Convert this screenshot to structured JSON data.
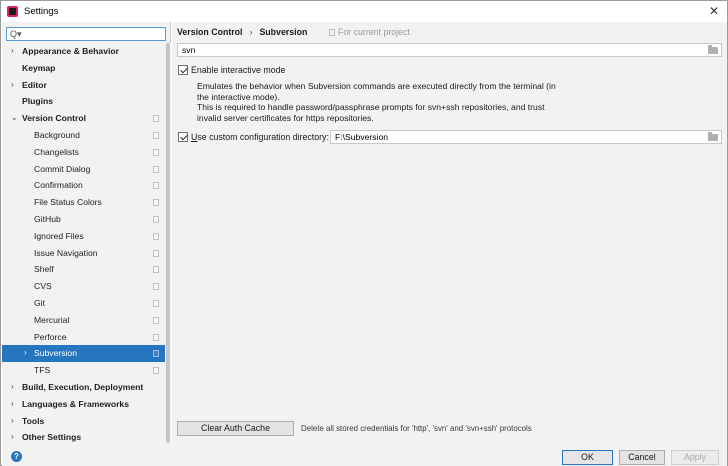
{
  "window": {
    "title": "Settings",
    "close_glyph": "✕"
  },
  "sidebar": {
    "search_glyph": "Q▾",
    "items": [
      {
        "label": "Appearance & Behavior",
        "bold": true,
        "arrow": "›",
        "depth": 0
      },
      {
        "label": "Keymap",
        "bold": true,
        "arrow": "",
        "depth": 0
      },
      {
        "label": "Editor",
        "bold": true,
        "arrow": "›",
        "depth": 0
      },
      {
        "label": "Plugins",
        "bold": true,
        "arrow": "",
        "depth": 0
      },
      {
        "label": "Version Control",
        "bold": true,
        "arrow": "⌄",
        "depth": 0,
        "project": true
      },
      {
        "label": "Background",
        "depth": 1,
        "project": true
      },
      {
        "label": "Changelists",
        "depth": 1,
        "project": true
      },
      {
        "label": "Commit Dialog",
        "depth": 1,
        "project": true
      },
      {
        "label": "Confirmation",
        "depth": 1,
        "project": true
      },
      {
        "label": "File Status Colors",
        "depth": 1,
        "project": true
      },
      {
        "label": "GitHub",
        "depth": 1,
        "project": true
      },
      {
        "label": "Ignored Files",
        "depth": 1,
        "project": true
      },
      {
        "label": "Issue Navigation",
        "depth": 1,
        "project": true
      },
      {
        "label": "Shelf",
        "depth": 1,
        "project": true
      },
      {
        "label": "CVS",
        "depth": 1,
        "project": true
      },
      {
        "label": "Git",
        "depth": 1,
        "project": true
      },
      {
        "label": "Mercurial",
        "depth": 1,
        "project": true
      },
      {
        "label": "Perforce",
        "depth": 1,
        "project": true
      },
      {
        "label": "Subversion",
        "depth": 1,
        "project": true,
        "arrow": "›",
        "selected": true
      },
      {
        "label": "TFS",
        "depth": 1,
        "project": true
      },
      {
        "label": "Build, Execution, Deployment",
        "bold": true,
        "arrow": "›",
        "depth": 0
      },
      {
        "label": "Languages & Frameworks",
        "bold": true,
        "arrow": "›",
        "depth": 0
      },
      {
        "label": "Tools",
        "bold": true,
        "arrow": "›",
        "depth": 0
      },
      {
        "label": "Other Settings",
        "bold": true,
        "arrow": "›",
        "depth": 0
      }
    ]
  },
  "main": {
    "breadcrumb": {
      "parent": "Version Control",
      "separator": "›",
      "current": "Subversion"
    },
    "for_project": "For current project",
    "path_value": "svn",
    "interactive_mode": {
      "checked": true,
      "label": "Enable interactive mode",
      "description": [
        "Emulates the behavior when Subversion commands are executed directly from the terminal (in",
        "the interactive mode).",
        "This is required to handle password/passphrase prompts for svn+ssh repositories, and trust",
        "invalid server certificates for https repositories."
      ]
    },
    "custom_config": {
      "checked": true,
      "label_mnemonic": "U",
      "label_rest": "se custom configuration directory:",
      "value": "F:\\Subversion"
    },
    "clear_auth": {
      "button": "Clear Auth Cache",
      "note": "Delete all stored credentials for 'http', 'svn' and 'svn+ssh' protocols"
    }
  },
  "footer": {
    "help_glyph": "?",
    "ok": "OK",
    "cancel": "Cancel",
    "apply": "Apply"
  },
  "colors": {
    "selection": "#2675bf",
    "panel": "#f2f2f2",
    "disabled_text": "#a8a8a8"
  }
}
